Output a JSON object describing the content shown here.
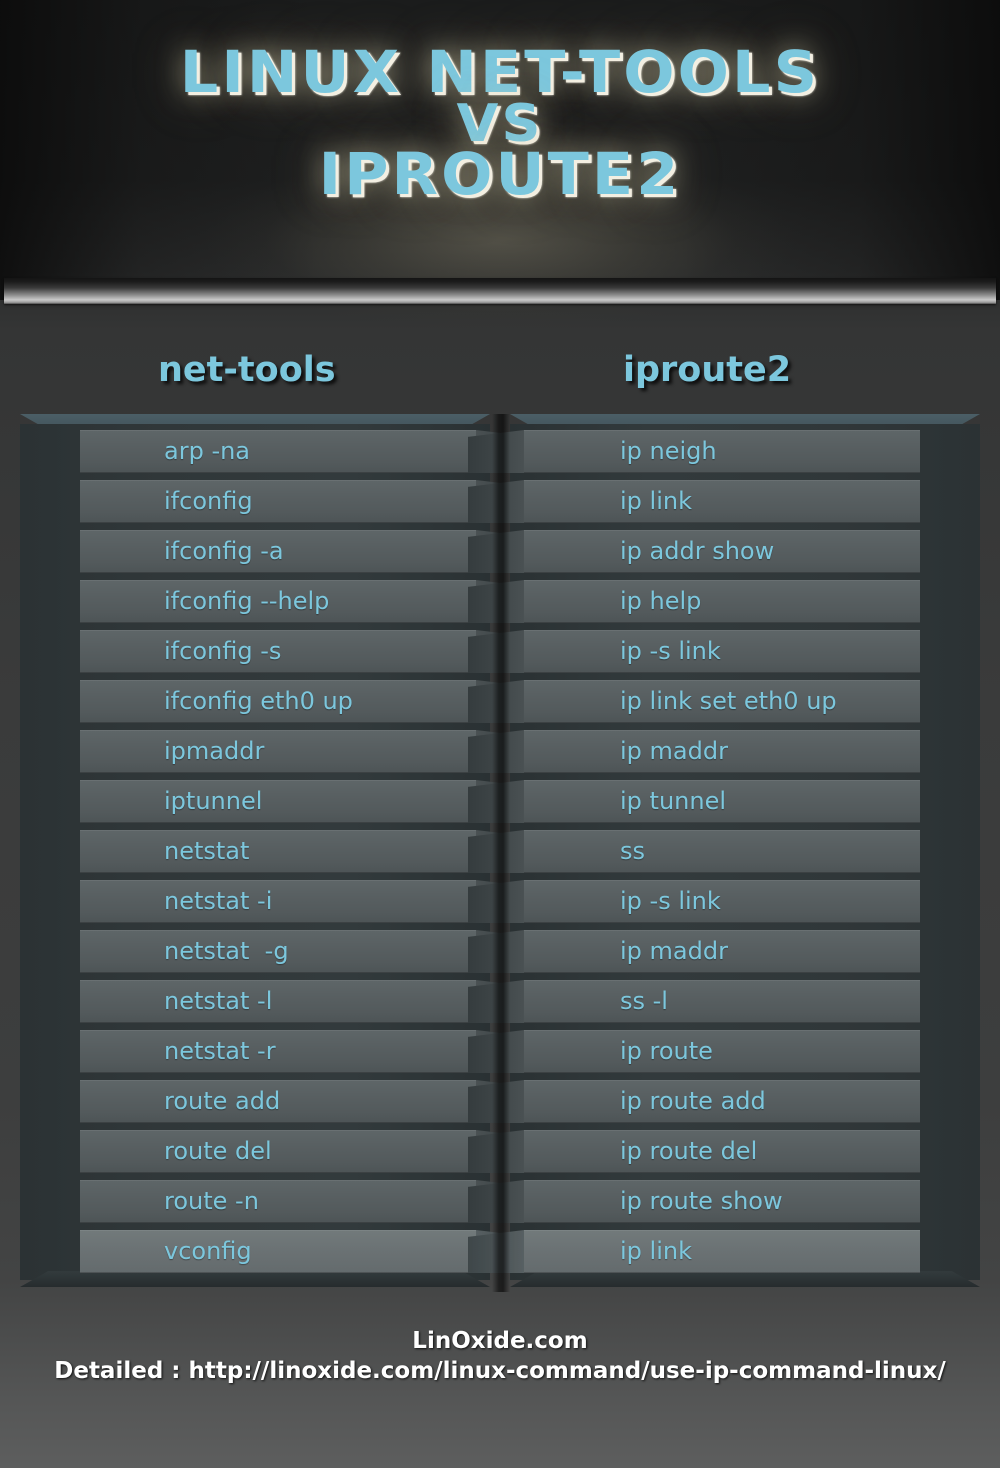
{
  "title": {
    "line1": "LINUX NET-TOOLS",
    "line2": "VS",
    "line3": "IPROUTE2"
  },
  "columns": {
    "left_header": "net-tools",
    "right_header": "iproute2"
  },
  "colors": {
    "accent_text": "#7cc7dd",
    "row_face": "#5a6264",
    "frame": "#2e3638",
    "top_bevel": "#44555c",
    "footer_text": "#ffffff"
  },
  "rows": [
    {
      "net_tools": "arp -na",
      "iproute2": "ip neigh"
    },
    {
      "net_tools": "ifconfig",
      "iproute2": "ip link"
    },
    {
      "net_tools": "ifconfig -a",
      "iproute2": "ip addr show"
    },
    {
      "net_tools": "ifconfig --help",
      "iproute2": "ip help"
    },
    {
      "net_tools": "ifconfig -s",
      "iproute2": "ip -s link"
    },
    {
      "net_tools": "ifconfig eth0 up",
      "iproute2": "ip link set eth0 up"
    },
    {
      "net_tools": "ipmaddr",
      "iproute2": "ip maddr"
    },
    {
      "net_tools": "iptunnel",
      "iproute2": "ip tunnel"
    },
    {
      "net_tools": "netstat",
      "iproute2": "ss"
    },
    {
      "net_tools": "netstat -i",
      "iproute2": "ip -s link"
    },
    {
      "net_tools": "netstat  -g",
      "iproute2": "ip maddr"
    },
    {
      "net_tools": "netstat -l",
      "iproute2": "ss -l"
    },
    {
      "net_tools": "netstat -r",
      "iproute2": "ip route"
    },
    {
      "net_tools": "route add",
      "iproute2": "ip route add"
    },
    {
      "net_tools": "route del",
      "iproute2": "ip route del"
    },
    {
      "net_tools": "route -n",
      "iproute2": "ip route show"
    },
    {
      "net_tools": "vconfig",
      "iproute2": "ip link"
    }
  ],
  "footer": {
    "site": "LinOxide.com",
    "url": "Detailed : http://linoxide.com/linux-command/use-ip-command-linux/"
  }
}
